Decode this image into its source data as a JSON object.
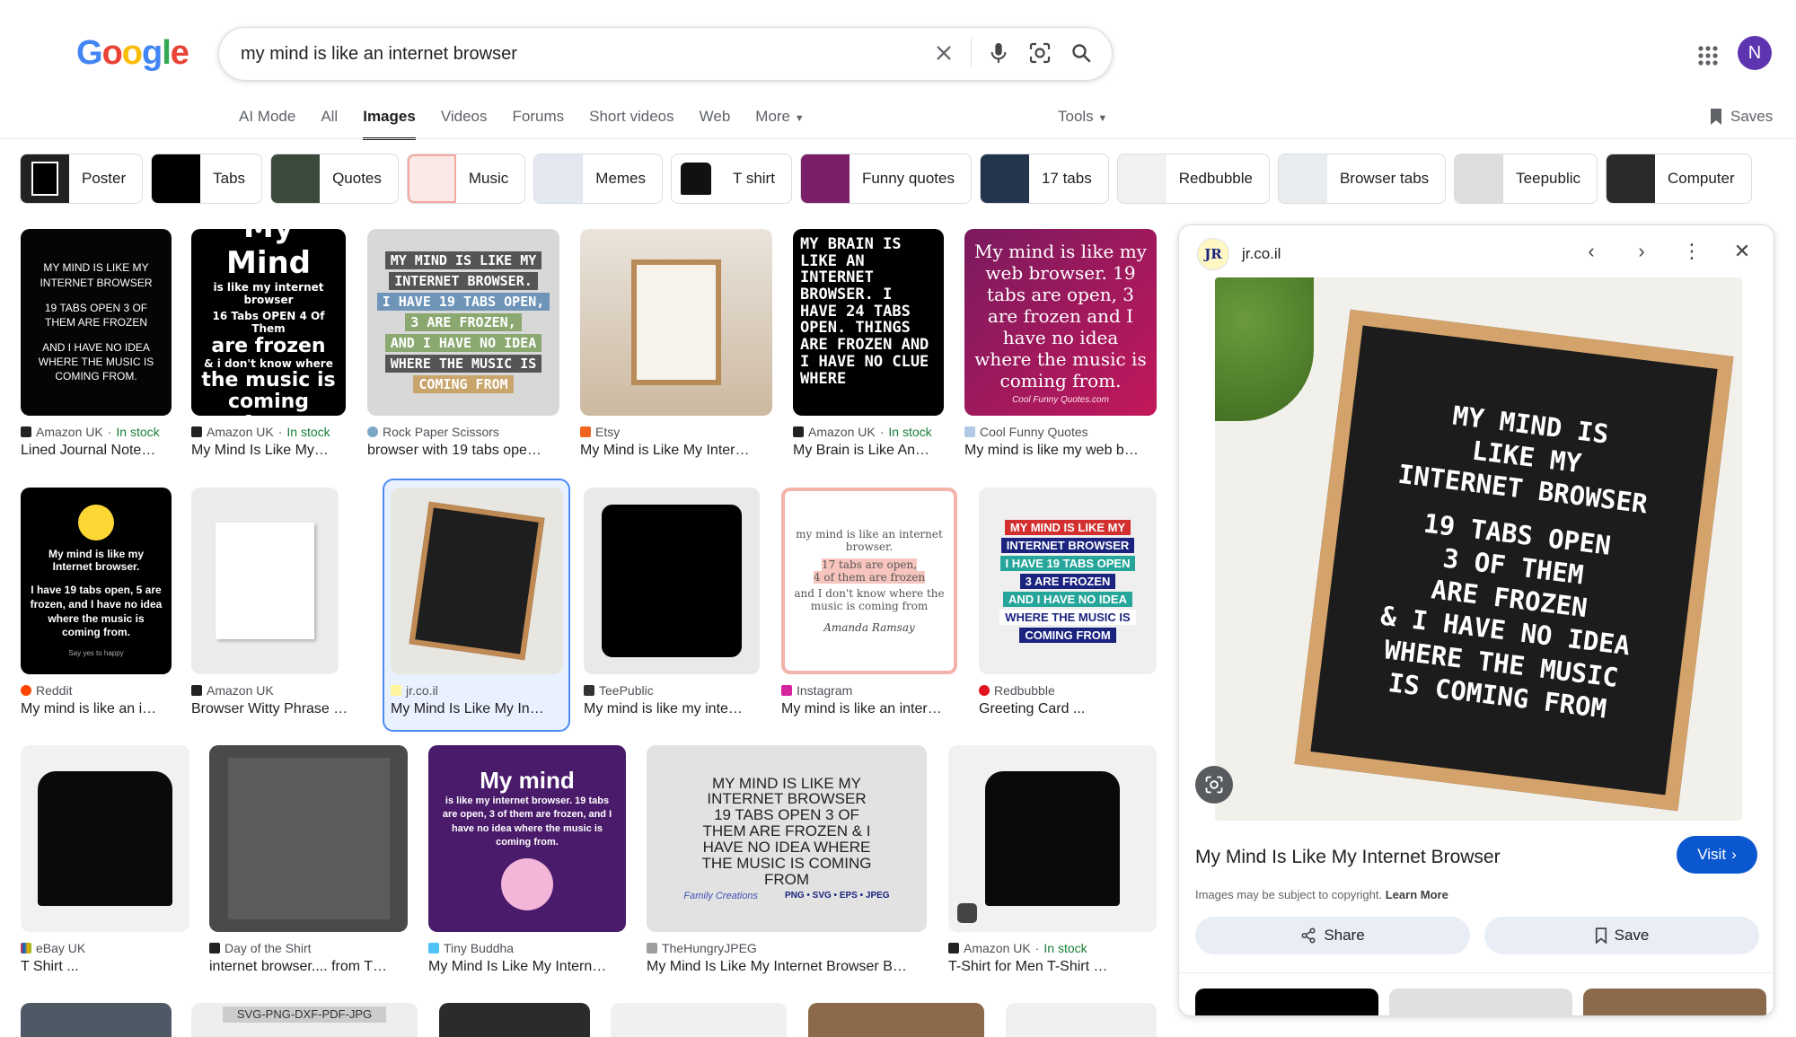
{
  "search": {
    "query": "my mind is like an internet browser"
  },
  "header": {
    "avatar_letter": "N",
    "saves_label": "Saves",
    "tools_label": "Tools"
  },
  "tabs": [
    "AI Mode",
    "All",
    "Images",
    "Videos",
    "Forums",
    "Short videos",
    "Web",
    "More"
  ],
  "chips": [
    "Poster",
    "Tabs",
    "Quotes",
    "Music",
    "Memes",
    "T shirt",
    "Funny quotes",
    "17 tabs",
    "Redbubble",
    "Browser tabs",
    "Teepublic",
    "Computer"
  ],
  "results": [
    {
      "source": "Amazon UK",
      "stock": "In stock",
      "title": "Lined Journal Note…"
    },
    {
      "source": "Amazon UK",
      "stock": "In stock",
      "title": "My Mind Is Like My…"
    },
    {
      "source": "Rock Paper Scissors",
      "stock": "",
      "title": "browser with 19 tabs ope…"
    },
    {
      "source": "Etsy",
      "stock": "",
      "title": "My Mind is Like My Inter…"
    },
    {
      "source": "Amazon UK",
      "stock": "In stock",
      "title": "My Brain is Like An…"
    },
    {
      "source": "Cool Funny Quotes",
      "stock": "",
      "title": "My mind is like my web b…"
    },
    {
      "source": "Reddit",
      "stock": "",
      "title": "My mind is like an i…"
    },
    {
      "source": "Amazon UK",
      "stock": "",
      "title": "Browser Witty Phrase …"
    },
    {
      "source": "jr.co.il",
      "stock": "",
      "title": "My Mind Is Like My In…"
    },
    {
      "source": "TeePublic",
      "stock": "",
      "title": "My mind is like my inte…"
    },
    {
      "source": "Instagram",
      "stock": "",
      "title": "My mind is like an inter…"
    },
    {
      "source": "Redbubble",
      "stock": "",
      "title": "Greeting Card ..."
    },
    {
      "source": "eBay UK",
      "stock": "",
      "title": "T Shirt ..."
    },
    {
      "source": "Day of the Shirt",
      "stock": "",
      "title": "internet browser.... from T…"
    },
    {
      "source": "Tiny Buddha",
      "stock": "",
      "title": "My Mind Is Like My Intern…"
    },
    {
      "source": "TheHungryJPEG",
      "stock": "",
      "title": "My Mind Is Like My Internet Browser B…"
    },
    {
      "source": "Amazon UK",
      "stock": "In stock",
      "title": "T-Shirt for Men T-Shirt …"
    }
  ],
  "image_text": {
    "r1": "MY MIND IS LIKE MY INTERNET BROWSER",
    "r1b": "19 TABS OPEN 3 OF THEM ARE FROZEN",
    "r1c": "AND I HAVE NO IDEA WHERE THE MUSIC IS COMING FROM.",
    "r2a": "My Mind",
    "r2b": "is like my internet browser",
    "r2c": "16 Tabs OPEN 4 Of Them",
    "r2d": "are frozen",
    "r2e": "& i don't know where",
    "r2f": "the music is coming from",
    "r3": [
      "MY MIND IS LIKE MY",
      "INTERNET BROWSER.",
      "I HAVE 19 TABS OPEN,",
      "3 ARE FROZEN,",
      "AND I HAVE NO IDEA",
      "WHERE THE MUSIC IS",
      "COMING FROM"
    ],
    "r5": "MY BRAIN IS LIKE AN INTERNET BROWSER. I HAVE 24 TABS OPEN. THINGS ARE FROZEN AND I HAVE NO CLUE WHERE",
    "r6": "My mind is like my web browser. 19 tabs are open, 3 are frozen and I have no idea where the music is coming from.",
    "r6b": "Cool Funny Quotes.com",
    "r7": "My mind is like my Internet browser.",
    "r7b": "I have 19 tabs open, 5 are frozen, and I have no idea where the music is coming from.",
    "r7c": "Say yes to happy",
    "r10a": "my mind is like an internet browser.",
    "r10b": "17 tabs are open,",
    "r10c": "4 of them are frozen",
    "r10d": "and I don't know where the music is coming from",
    "r10e": "Amanda Ramsay",
    "r11": [
      "MY MIND IS LIKE MY",
      "INTERNET BROWSER",
      "I HAVE 19 TABS OPEN",
      "3 ARE FROZEN",
      "AND I HAVE NO IDEA",
      "WHERE THE MUSIC IS",
      "COMING FROM"
    ],
    "r14a": "My mind",
    "r14b": "is like my internet browser. 19 tabs are open, 3 of them are frozen, and I have no idea where the music is coming from.",
    "r15": "MY MIND IS LIKE MY INTERNET BROWSER 19 TABS OPEN 3 OF THEM ARE FROZEN & I HAVE NO IDEA WHERE THE MUSIC IS COMING FROM",
    "r15b": "Family Creations",
    "r15c": "PNG • SVG • EPS • JPEG",
    "row4_banner": "SVG-PNG-DXF-PDF-JPG"
  },
  "panel": {
    "source": "jr.co.il",
    "fav": "JR",
    "board_lines": [
      "MY MIND IS",
      "LIKE MY",
      "INTERNET BROWSER",
      "19 TABS OPEN",
      "3 OF THEM",
      "ARE FROZEN",
      "& I HAVE NO IDEA",
      "WHERE THE MUSIC",
      "IS COMING FROM"
    ],
    "title": "My Mind Is Like My Internet Browser",
    "visit": "Visit",
    "copyright": "Images may be subject to copyright.",
    "learn_more": "Learn More",
    "share": "Share",
    "save": "Save"
  },
  "colors": {
    "accent": "#0b57d0",
    "stock": "#188038",
    "selected_border": "#4c8bf5"
  }
}
